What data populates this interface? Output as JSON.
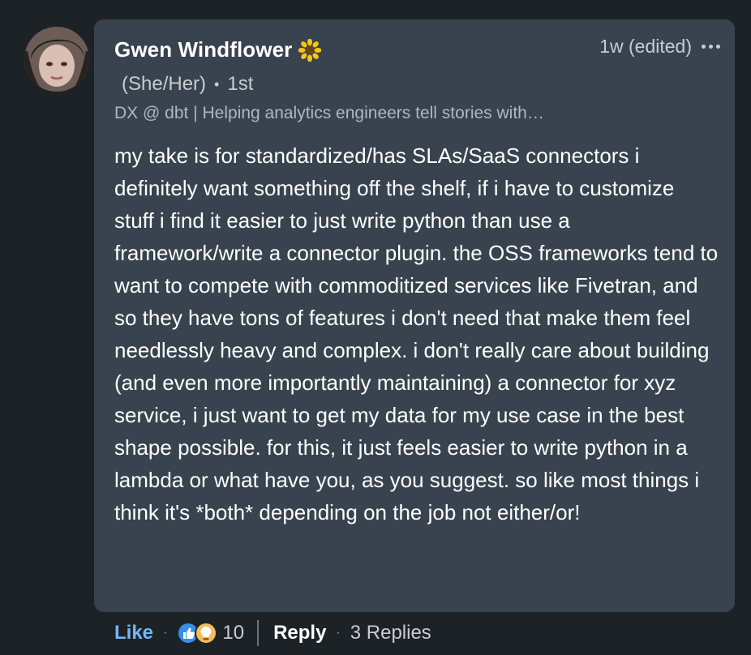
{
  "comment": {
    "author_name": "Gwen Windflower",
    "author_icon": "sunflower-icon",
    "pronouns": "(She/Her)",
    "connection_degree": "1st",
    "headline": "DX @ dbt | Helping analytics engineers tell stories with…",
    "timestamp": "1w (edited)",
    "body": "my take is for standardized/has SLAs/SaaS connectors i definitely want something off the shelf, if i have to customize stuff i find it easier to just write python than use a framework/write a connector plugin. the OSS frameworks tend to want to compete with commoditized services like Fivetran, and so they have tons of features i don't need that make them feel needlessly heavy and complex. i don't really care about building (and even more importantly maintaining) a connector for xyz service, i just want to get my data for my use case in the best shape possible. for this, it just feels easier to write python in a lambda or what have you, as you suggest. so like most things i think it's *both* depending on the job not either/or!"
  },
  "actions": {
    "like_label": "Like",
    "separator": "·",
    "reactions": [
      "like-icon",
      "insightful-icon"
    ],
    "reaction_count": "10",
    "reply_label": "Reply",
    "replies_label": "3 Replies"
  },
  "colors": {
    "background": "#1d2226",
    "bubble": "#38434f",
    "link_blue": "#71b7fb",
    "muted_text": "#c8ccd0"
  }
}
